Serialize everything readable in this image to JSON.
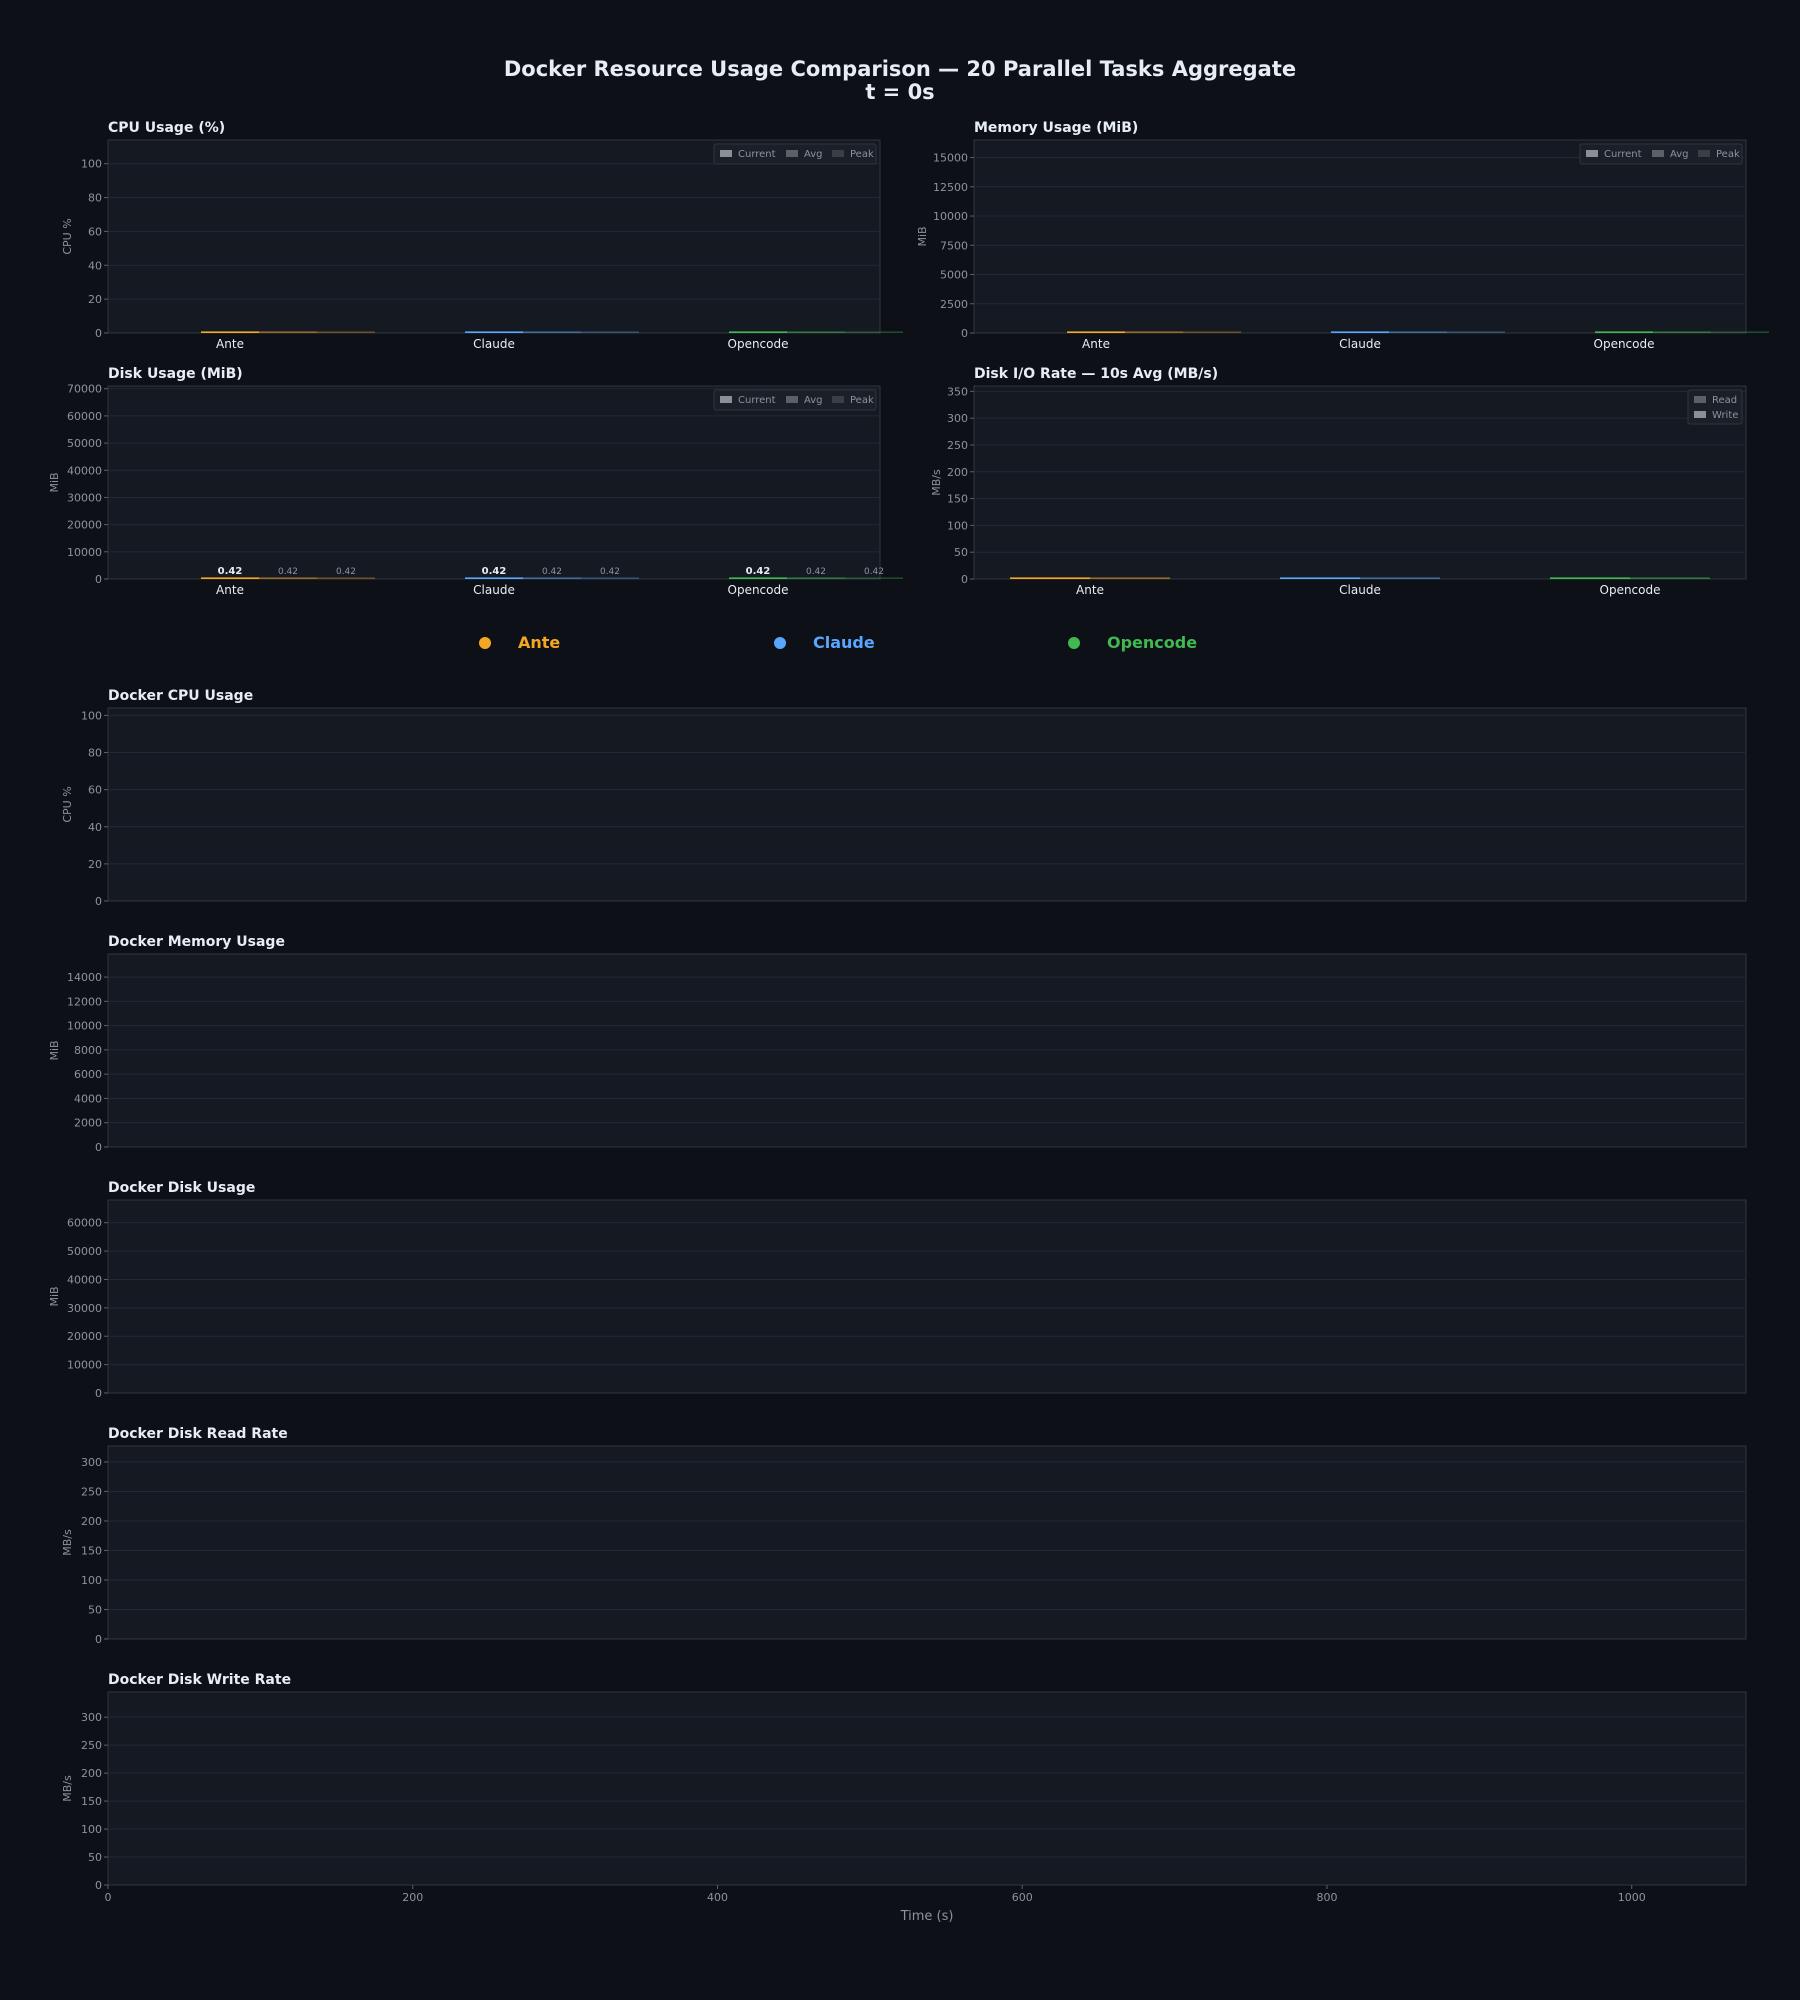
{
  "title_line1": "Docker Resource Usage Comparison — 20 Parallel Tasks Aggregate",
  "title_line2": "t = 0s",
  "colors": {
    "background": "#0d1017",
    "panel": "#151922",
    "ante": "#f5a623",
    "claude": "#58a6ff",
    "opencode": "#3fb950",
    "text": "#e6edf3",
    "muted": "#8b949e"
  },
  "agents_legend": [
    {
      "name": "Ante",
      "color": "#f5a623"
    },
    {
      "name": "Claude",
      "color": "#58a6ff"
    },
    {
      "name": "Opencode",
      "color": "#3fb950"
    }
  ],
  "chart_data": [
    {
      "id": "cpu_bar",
      "type": "bar",
      "title": "CPU Usage (%)",
      "ylabel": "CPU %",
      "ylim": [
        0,
        114
      ],
      "yticks": [
        0,
        20,
        40,
        60,
        80,
        100
      ],
      "categories": [
        "Ante",
        "Claude",
        "Opencode"
      ],
      "series": [
        {
          "name": "Current",
          "values": [
            0,
            0,
            0
          ]
        },
        {
          "name": "Avg",
          "values": [
            0,
            0,
            0
          ]
        },
        {
          "name": "Peak",
          "values": [
            0,
            0,
            0
          ]
        }
      ],
      "legend": "top-right",
      "grid": true,
      "value_labels": false
    },
    {
      "id": "mem_bar",
      "type": "bar",
      "title": "Memory Usage (MiB)",
      "ylabel": "MiB",
      "ylim": [
        0,
        16500
      ],
      "yticks": [
        0,
        2500,
        5000,
        7500,
        10000,
        12500,
        15000
      ],
      "categories": [
        "Ante",
        "Claude",
        "Opencode"
      ],
      "series": [
        {
          "name": "Current",
          "values": [
            0,
            0,
            0
          ]
        },
        {
          "name": "Avg",
          "values": [
            0,
            0,
            0
          ]
        },
        {
          "name": "Peak",
          "values": [
            0,
            0,
            0
          ]
        }
      ],
      "legend": "top-right",
      "grid": true,
      "value_labels": false
    },
    {
      "id": "disk_bar",
      "type": "bar",
      "title": "Disk Usage (MiB)",
      "ylabel": "MiB",
      "ylim": [
        0,
        71000
      ],
      "yticks": [
        0,
        10000,
        20000,
        30000,
        40000,
        50000,
        60000,
        70000
      ],
      "categories": [
        "Ante",
        "Claude",
        "Opencode"
      ],
      "series": [
        {
          "name": "Current",
          "values": [
            0.42,
            0.42,
            0.42
          ]
        },
        {
          "name": "Avg",
          "values": [
            0.42,
            0.42,
            0.42
          ]
        },
        {
          "name": "Peak",
          "values": [
            0.42,
            0.42,
            0.42
          ]
        }
      ],
      "legend": "top-right",
      "grid": true,
      "value_labels": true
    },
    {
      "id": "io_bar",
      "type": "bar",
      "title": "Disk I/O Rate — 10s Avg (MB/s)",
      "ylabel": "MB/s",
      "ylim": [
        0,
        360
      ],
      "yticks": [
        0,
        50,
        100,
        150,
        200,
        250,
        300,
        350
      ],
      "categories": [
        "Ante",
        "Claude",
        "Opencode"
      ],
      "series": [
        {
          "name": "Read",
          "values": [
            0,
            0,
            0
          ]
        },
        {
          "name": "Write",
          "values": [
            0,
            0,
            0
          ]
        }
      ],
      "legend": "top-right",
      "grid": true,
      "value_labels": false
    },
    {
      "id": "cpu_line",
      "type": "line",
      "title": "Docker CPU Usage",
      "ylabel": "CPU %",
      "xlim": [
        0,
        1075
      ],
      "ylim": [
        0,
        104
      ],
      "yticks": [
        0,
        20,
        40,
        60,
        80,
        100
      ],
      "series": [],
      "grid": true
    },
    {
      "id": "mem_line",
      "type": "line",
      "title": "Docker Memory Usage",
      "ylabel": "MiB",
      "xlim": [
        0,
        1075
      ],
      "ylim": [
        0,
        15900
      ],
      "yticks": [
        0,
        2000,
        4000,
        6000,
        8000,
        10000,
        12000,
        14000
      ],
      "series": [],
      "grid": true
    },
    {
      "id": "disk_line",
      "type": "line",
      "title": "Docker Disk Usage",
      "ylabel": "MiB",
      "xlim": [
        0,
        1075
      ],
      "ylim": [
        0,
        68000
      ],
      "yticks": [
        0,
        10000,
        20000,
        30000,
        40000,
        50000,
        60000
      ],
      "series": [],
      "grid": true
    },
    {
      "id": "read_line",
      "type": "line",
      "title": "Docker Disk Read Rate",
      "ylabel": "MB/s",
      "xlim": [
        0,
        1075
      ],
      "ylim": [
        0,
        327
      ],
      "yticks": [
        0,
        50,
        100,
        150,
        200,
        250,
        300
      ],
      "series": [],
      "grid": true
    },
    {
      "id": "write_line",
      "type": "line",
      "title": "Docker Disk Write Rate",
      "ylabel": "MB/s",
      "xlim": [
        0,
        1075
      ],
      "ylim": [
        0,
        345
      ],
      "yticks": [
        0,
        50,
        100,
        150,
        200,
        250,
        300
      ],
      "xticks": [
        0,
        200,
        400,
        600,
        800,
        1000
      ],
      "xlabel": "Time (s)",
      "series": [],
      "grid": true
    }
  ]
}
